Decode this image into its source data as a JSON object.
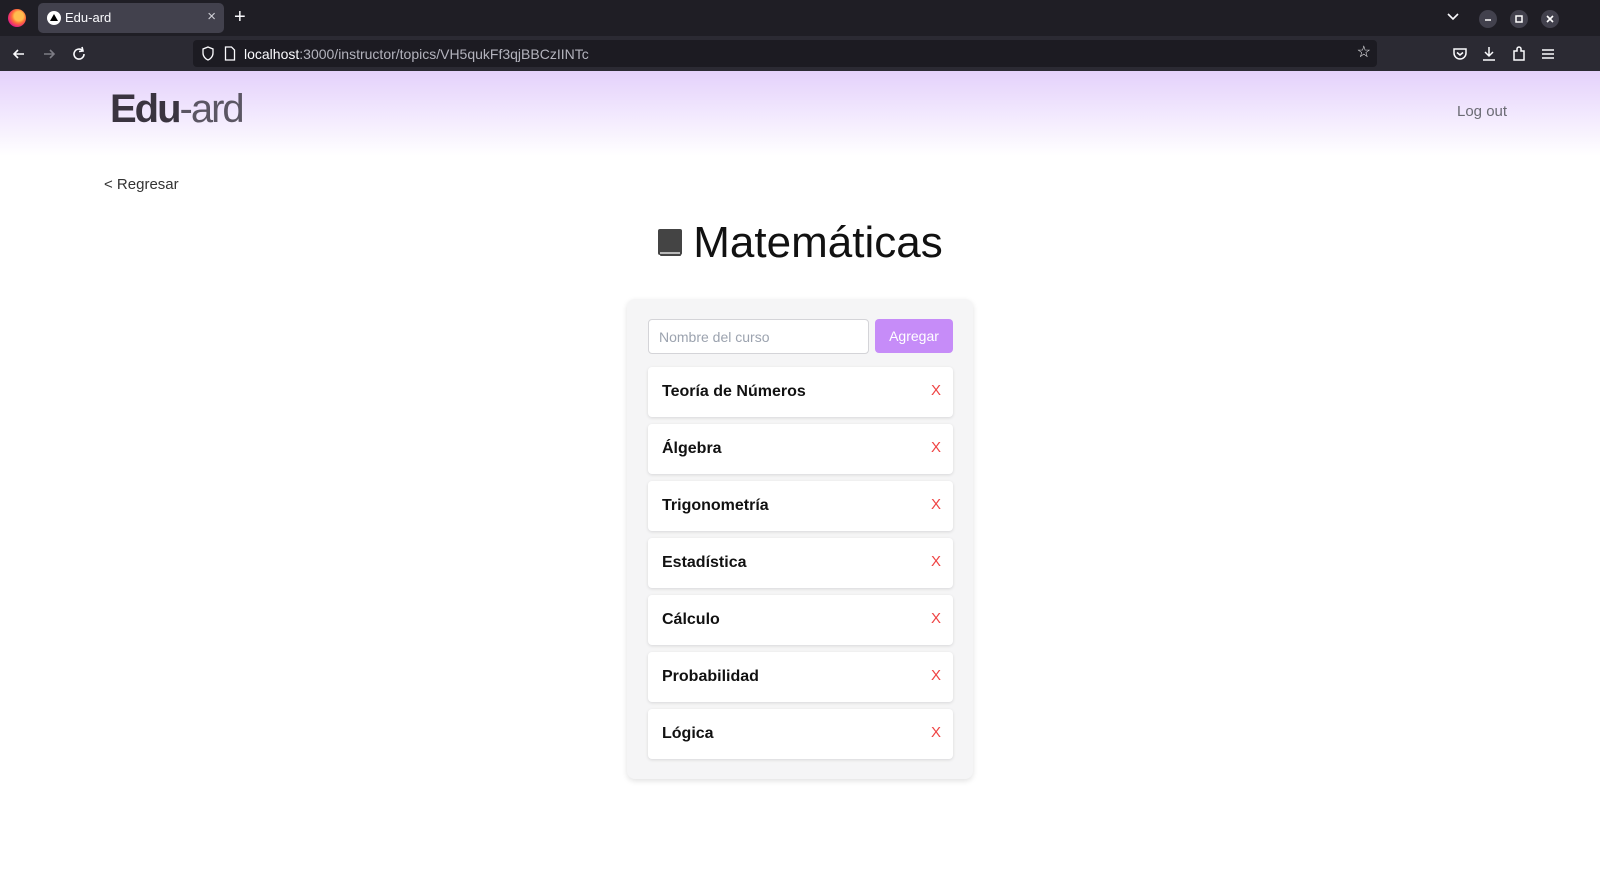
{
  "browser": {
    "tab_title": "Edu-ard",
    "tab_close": "×",
    "new_tab": "+",
    "url_host": "localhost",
    "url_path": ":3000/instructor/topics/VH5qukFf3qjBBCzIINTc",
    "icons": [
      "firefox-logo",
      "back-arrow-icon",
      "forward-arrow-icon",
      "reload-icon",
      "shield-icon",
      "page-icon",
      "star-icon",
      "pocket-icon",
      "download-icon",
      "extensions-icon",
      "menu-icon",
      "tab-list-icon",
      "minimize-icon",
      "maximize-icon",
      "close-window-icon"
    ]
  },
  "header": {
    "brand_bold": "Edu",
    "brand_light": "-ard",
    "logout_label": "Log out",
    "gradient_color": "#e4d1fb"
  },
  "nav": {
    "back_label": "< Regresar"
  },
  "topic": {
    "title": "Matemáticas",
    "icon": "book-icon"
  },
  "form": {
    "input_placeholder": "Nombre del curso",
    "input_value": "",
    "add_label": "Agregar",
    "accent": "#c68cf8"
  },
  "courses": [
    {
      "name": "Teoría de Números",
      "delete": "X"
    },
    {
      "name": "Álgebra",
      "delete": "X"
    },
    {
      "name": "Trigonometría",
      "delete": "X"
    },
    {
      "name": "Estadística",
      "delete": "X"
    },
    {
      "name": "Cálculo",
      "delete": "X"
    },
    {
      "name": "Probabilidad",
      "delete": "X"
    },
    {
      "name": "Lógica",
      "delete": "X"
    }
  ],
  "delete_color": "#ef4444"
}
